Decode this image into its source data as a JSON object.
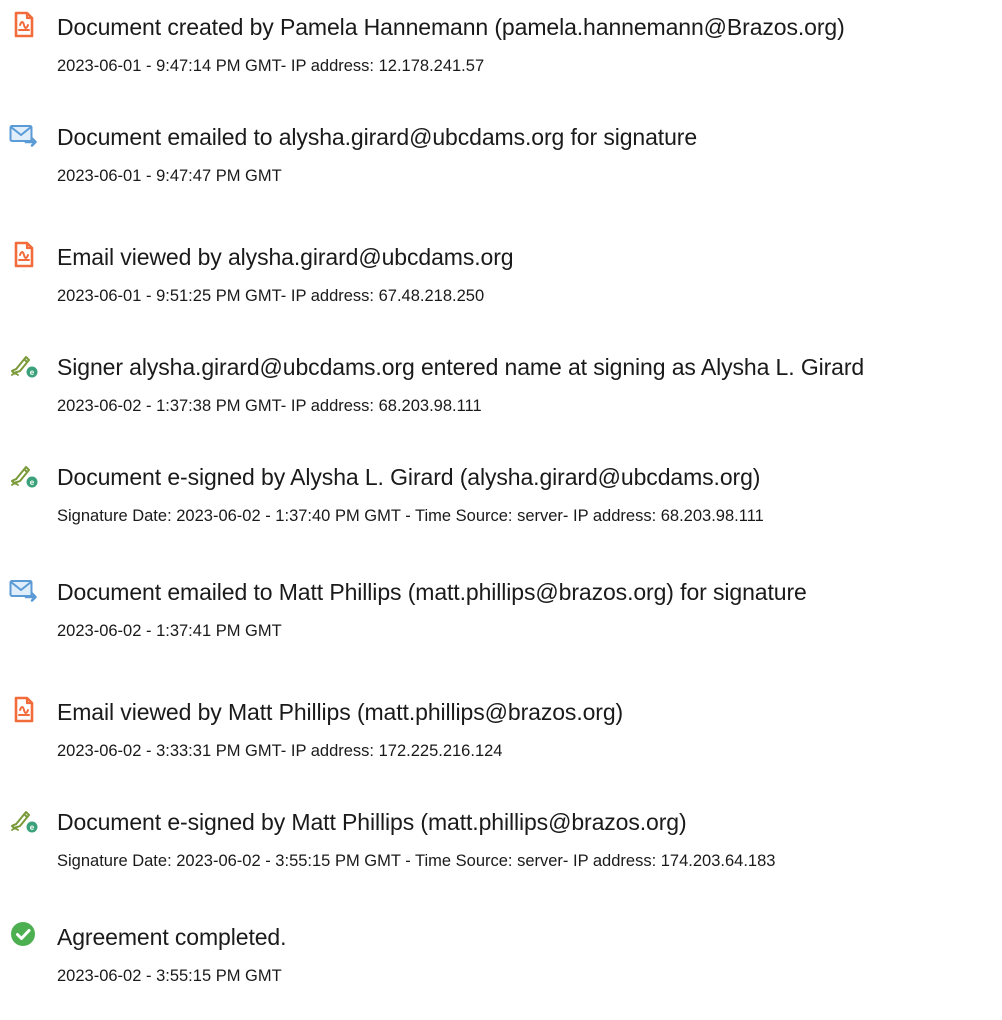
{
  "audit_trail": {
    "events": [
      {
        "icon": "document-created-icon",
        "title": "Document created by Pamela Hannemann (pamela.hannemann@Brazos.org)",
        "detail": "2023-06-01 - 9:47:14 PM GMT- IP address: 12.178.241.57"
      },
      {
        "icon": "email-sent-icon",
        "title": "Document emailed to alysha.girard@ubcdams.org for signature",
        "detail": "2023-06-01 - 9:47:47 PM GMT"
      },
      {
        "icon": "document-viewed-icon",
        "title": "Email viewed by alysha.girard@ubcdams.org",
        "detail": "2023-06-01 - 9:51:25 PM GMT- IP address: 67.48.218.250"
      },
      {
        "icon": "e-sign-icon",
        "title": "Signer alysha.girard@ubcdams.org entered name at signing as Alysha L. Girard",
        "detail": "2023-06-02 - 1:37:38 PM GMT- IP address: 68.203.98.111"
      },
      {
        "icon": "e-sign-icon",
        "title": "Document e-signed by Alysha L. Girard (alysha.girard@ubcdams.org)",
        "detail": "Signature Date: 2023-06-02 - 1:37:40 PM GMT - Time Source: server- IP address: 68.203.98.111"
      },
      {
        "icon": "email-sent-icon",
        "title": "Document emailed to Matt Phillips (matt.phillips@brazos.org) for signature",
        "detail": "2023-06-02 - 1:37:41 PM GMT"
      },
      {
        "icon": "document-viewed-icon",
        "title": "Email viewed by Matt Phillips (matt.phillips@brazos.org)",
        "detail": "2023-06-02 - 3:33:31 PM GMT- IP address: 172.225.216.124"
      },
      {
        "icon": "e-sign-icon",
        "title": "Document e-signed by Matt Phillips (matt.phillips@brazos.org)",
        "detail": "Signature Date: 2023-06-02 - 3:55:15 PM GMT - Time Source: server- IP address: 174.203.64.183"
      },
      {
        "icon": "agreement-completed-icon",
        "title": "Agreement completed.",
        "detail": "2023-06-02 - 3:55:15 PM GMT"
      }
    ],
    "colors": {
      "document_icon": "#f26b3a",
      "email_icon": "#5b9bd5",
      "sign_icon_pen": "#7a9a3a",
      "sign_icon_badge": "#3aa17a",
      "completed_icon": "#4caf50",
      "text": "#1a1a1a"
    }
  }
}
